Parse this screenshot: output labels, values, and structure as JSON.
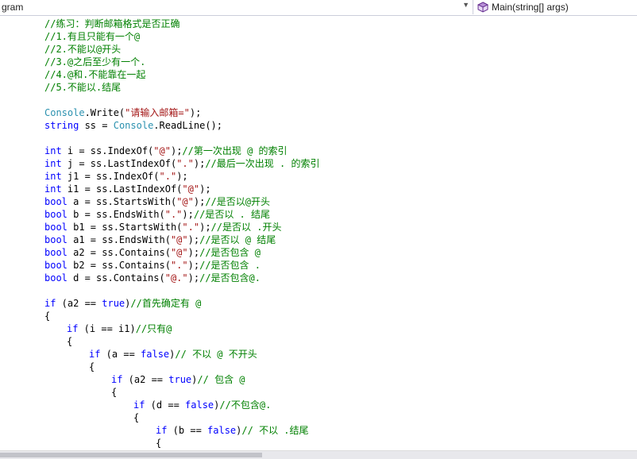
{
  "navbar": {
    "left_dropdown": "gram",
    "right_dropdown": "Main(string[] args)"
  },
  "colors": {
    "keyword": "#0000ff",
    "type": "#2b91af",
    "string": "#a31515",
    "comment": "#008000",
    "plain": "#000000"
  },
  "code_lines": [
    {
      "indent": 0,
      "parts": [
        {
          "t": "c",
          "s": "//练习：判断邮箱格式是否正确"
        }
      ]
    },
    {
      "indent": 0,
      "parts": [
        {
          "t": "c",
          "s": "//1.有且只能有一个@"
        }
      ]
    },
    {
      "indent": 0,
      "parts": [
        {
          "t": "c",
          "s": "//2.不能以@开头"
        }
      ]
    },
    {
      "indent": 0,
      "parts": [
        {
          "t": "c",
          "s": "//3.@之后至少有一个."
        }
      ]
    },
    {
      "indent": 0,
      "parts": [
        {
          "t": "c",
          "s": "//4.@和.不能靠在一起"
        }
      ]
    },
    {
      "indent": 0,
      "parts": [
        {
          "t": "c",
          "s": "//5.不能以.结尾"
        }
      ]
    },
    {
      "indent": 0,
      "parts": []
    },
    {
      "indent": 0,
      "parts": [
        {
          "t": "y",
          "s": "Console"
        },
        {
          "t": "p",
          "s": ".Write("
        },
        {
          "t": "s",
          "s": "\"请输入邮箱=\""
        },
        {
          "t": "p",
          "s": ");"
        }
      ]
    },
    {
      "indent": 0,
      "parts": [
        {
          "t": "k",
          "s": "string"
        },
        {
          "t": "p",
          "s": " ss = "
        },
        {
          "t": "y",
          "s": "Console"
        },
        {
          "t": "p",
          "s": ".ReadLine();"
        }
      ]
    },
    {
      "indent": 0,
      "parts": []
    },
    {
      "indent": 0,
      "parts": [
        {
          "t": "k",
          "s": "int"
        },
        {
          "t": "p",
          "s": " i = ss.IndexOf("
        },
        {
          "t": "s",
          "s": "\"@\""
        },
        {
          "t": "p",
          "s": ");"
        },
        {
          "t": "c",
          "s": "//第一次出现 @ 的索引"
        }
      ]
    },
    {
      "indent": 0,
      "parts": [
        {
          "t": "k",
          "s": "int"
        },
        {
          "t": "p",
          "s": " j = ss.LastIndexOf("
        },
        {
          "t": "s",
          "s": "\".\""
        },
        {
          "t": "p",
          "s": ");"
        },
        {
          "t": "c",
          "s": "//最后一次出现 . 的索引"
        }
      ]
    },
    {
      "indent": 0,
      "parts": [
        {
          "t": "k",
          "s": "int"
        },
        {
          "t": "p",
          "s": " j1 = ss.IndexOf("
        },
        {
          "t": "s",
          "s": "\".\""
        },
        {
          "t": "p",
          "s": ");"
        }
      ]
    },
    {
      "indent": 0,
      "parts": [
        {
          "t": "k",
          "s": "int"
        },
        {
          "t": "p",
          "s": " i1 = ss.LastIndexOf("
        },
        {
          "t": "s",
          "s": "\"@\""
        },
        {
          "t": "p",
          "s": ");"
        }
      ]
    },
    {
      "indent": 0,
      "parts": [
        {
          "t": "k",
          "s": "bool"
        },
        {
          "t": "p",
          "s": " a = ss.StartsWith("
        },
        {
          "t": "s",
          "s": "\"@\""
        },
        {
          "t": "p",
          "s": ");"
        },
        {
          "t": "c",
          "s": "//是否以@开头"
        }
      ]
    },
    {
      "indent": 0,
      "parts": [
        {
          "t": "k",
          "s": "bool"
        },
        {
          "t": "p",
          "s": " b = ss.EndsWith("
        },
        {
          "t": "s",
          "s": "\".\""
        },
        {
          "t": "p",
          "s": ");"
        },
        {
          "t": "c",
          "s": "//是否以 . 结尾"
        }
      ]
    },
    {
      "indent": 0,
      "parts": [
        {
          "t": "k",
          "s": "bool"
        },
        {
          "t": "p",
          "s": " b1 = ss.StartsWith("
        },
        {
          "t": "s",
          "s": "\".\""
        },
        {
          "t": "p",
          "s": ");"
        },
        {
          "t": "c",
          "s": "//是否以 .开头"
        }
      ]
    },
    {
      "indent": 0,
      "parts": [
        {
          "t": "k",
          "s": "bool"
        },
        {
          "t": "p",
          "s": " a1 = ss.EndsWith("
        },
        {
          "t": "s",
          "s": "\"@\""
        },
        {
          "t": "p",
          "s": ");"
        },
        {
          "t": "c",
          "s": "//是否以 @ 结尾"
        }
      ]
    },
    {
      "indent": 0,
      "parts": [
        {
          "t": "k",
          "s": "bool"
        },
        {
          "t": "p",
          "s": " a2 = ss.Contains("
        },
        {
          "t": "s",
          "s": "\"@\""
        },
        {
          "t": "p",
          "s": ");"
        },
        {
          "t": "c",
          "s": "//是否包含 @"
        }
      ]
    },
    {
      "indent": 0,
      "parts": [
        {
          "t": "k",
          "s": "bool"
        },
        {
          "t": "p",
          "s": " b2 = ss.Contains("
        },
        {
          "t": "s",
          "s": "\".\""
        },
        {
          "t": "p",
          "s": ");"
        },
        {
          "t": "c",
          "s": "//是否包含 ."
        }
      ]
    },
    {
      "indent": 0,
      "parts": [
        {
          "t": "k",
          "s": "bool"
        },
        {
          "t": "p",
          "s": " d = ss.Contains("
        },
        {
          "t": "s",
          "s": "\"@.\""
        },
        {
          "t": "p",
          "s": ");"
        },
        {
          "t": "c",
          "s": "//是否包含@."
        }
      ]
    },
    {
      "indent": 0,
      "parts": []
    },
    {
      "indent": 0,
      "parts": [
        {
          "t": "k",
          "s": "if"
        },
        {
          "t": "p",
          "s": " (a2 == "
        },
        {
          "t": "k",
          "s": "true"
        },
        {
          "t": "p",
          "s": ")"
        },
        {
          "t": "c",
          "s": "//首先确定有 @"
        }
      ]
    },
    {
      "indent": 0,
      "parts": [
        {
          "t": "p",
          "s": "{"
        }
      ]
    },
    {
      "indent": 1,
      "parts": [
        {
          "t": "k",
          "s": "if"
        },
        {
          "t": "p",
          "s": " (i == i1)"
        },
        {
          "t": "c",
          "s": "//只有@"
        }
      ]
    },
    {
      "indent": 1,
      "parts": [
        {
          "t": "p",
          "s": "{"
        }
      ]
    },
    {
      "indent": 2,
      "parts": [
        {
          "t": "k",
          "s": "if"
        },
        {
          "t": "p",
          "s": " (a == "
        },
        {
          "t": "k",
          "s": "false"
        },
        {
          "t": "p",
          "s": ")"
        },
        {
          "t": "c",
          "s": "// 不以 @ 不开头"
        }
      ]
    },
    {
      "indent": 2,
      "parts": [
        {
          "t": "p",
          "s": "{"
        }
      ]
    },
    {
      "indent": 3,
      "parts": [
        {
          "t": "k",
          "s": "if"
        },
        {
          "t": "p",
          "s": " (a2 == "
        },
        {
          "t": "k",
          "s": "true"
        },
        {
          "t": "p",
          "s": ")"
        },
        {
          "t": "c",
          "s": "// 包含 @"
        }
      ]
    },
    {
      "indent": 3,
      "parts": [
        {
          "t": "p",
          "s": "{"
        }
      ]
    },
    {
      "indent": 4,
      "parts": [
        {
          "t": "k",
          "s": "if"
        },
        {
          "t": "p",
          "s": " (d == "
        },
        {
          "t": "k",
          "s": "false"
        },
        {
          "t": "p",
          "s": ")"
        },
        {
          "t": "c",
          "s": "//不包含@."
        }
      ]
    },
    {
      "indent": 4,
      "parts": [
        {
          "t": "p",
          "s": "{"
        }
      ]
    },
    {
      "indent": 5,
      "parts": [
        {
          "t": "k",
          "s": "if"
        },
        {
          "t": "p",
          "s": " (b == "
        },
        {
          "t": "k",
          "s": "false"
        },
        {
          "t": "p",
          "s": ")"
        },
        {
          "t": "c",
          "s": "// 不以 .结尾"
        }
      ]
    },
    {
      "indent": 5,
      "parts": [
        {
          "t": "p",
          "s": "{"
        }
      ]
    }
  ]
}
